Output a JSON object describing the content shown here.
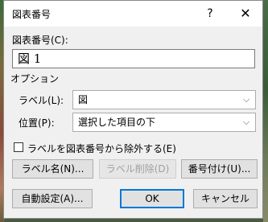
{
  "dialog": {
    "title": "図表番号",
    "help_label": "?",
    "close_label": "✕"
  },
  "caption": {
    "label": "図表番号(C):",
    "value": "図 1"
  },
  "options": {
    "section_label": "オプション",
    "label_field_label": "ラベル(L):",
    "label_value": "図",
    "position_field_label": "位置(P):",
    "position_value": "選択した項目の下",
    "exclude_label_text": "ラベルを図表番号から除外する(E)",
    "exclude_checked": false
  },
  "buttons": {
    "new_label": "ラベル名(N)...",
    "delete_label": "ラベル削除(D)",
    "numbering": "番号付け(U)...",
    "autocaption": "自動設定(A)...",
    "ok": "OK",
    "cancel": "キャンセル"
  },
  "icons": {
    "dropdown": "chevron-down-icon",
    "close": "close-icon"
  }
}
